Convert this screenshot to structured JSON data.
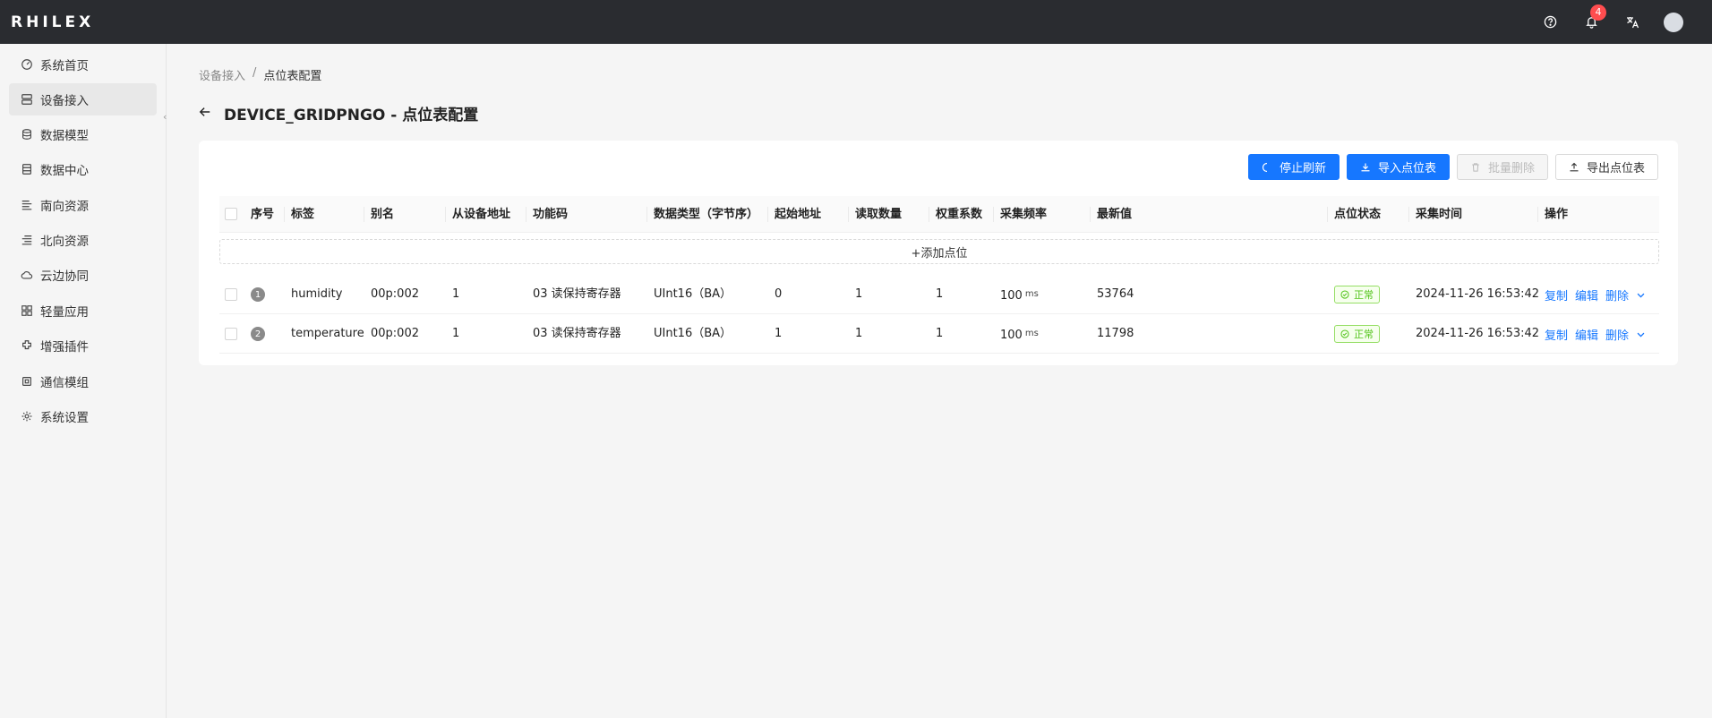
{
  "app": {
    "brand": "RHILEX",
    "notification_count": "4"
  },
  "sidebar": {
    "items": [
      {
        "label": "系统首页",
        "icon": "dashboard-icon"
      },
      {
        "label": "设备接入",
        "icon": "devices-icon"
      },
      {
        "label": "数据模型",
        "icon": "database-icon"
      },
      {
        "label": "数据中心",
        "icon": "table-icon"
      },
      {
        "label": "南向资源",
        "icon": "list-icon"
      },
      {
        "label": "北向资源",
        "icon": "list-icon"
      },
      {
        "label": "云边协同",
        "icon": "cloud-icon"
      },
      {
        "label": "轻量应用",
        "icon": "apps-icon"
      },
      {
        "label": "增强插件",
        "icon": "plugin-icon"
      },
      {
        "label": "通信模组",
        "icon": "chip-icon"
      },
      {
        "label": "系统设置",
        "icon": "gear-icon"
      }
    ]
  },
  "breadcrumb": {
    "parent": "设备接入",
    "separator": "/",
    "current": "点位表配置"
  },
  "page": {
    "title": "DEVICE_GRIDPNGO - 点位表配置"
  },
  "toolbar": {
    "stop_refresh": "停止刷新",
    "import": "导入点位表",
    "batch_delete": "批量删除",
    "export": "导出点位表"
  },
  "table": {
    "columns": [
      "序号",
      "标签",
      "别名",
      "从设备地址",
      "功能码",
      "数据类型（字节序）",
      "起始地址",
      "读取数量",
      "权重系数",
      "采集频率",
      "最新值",
      "点位状态",
      "采集时间",
      "操作"
    ],
    "add_point": "+添加点位",
    "rows": [
      {
        "index": "1",
        "tag": "humidity",
        "alias": "00p:002",
        "slave_addr": "1",
        "func_code": "03 读保持寄存器",
        "data_type": "UInt16（BA）",
        "start_addr": "0",
        "read_count": "1",
        "weight": "1",
        "freq": "100",
        "freq_unit": "ms",
        "latest": "53764",
        "status": "正常",
        "time": "2024-11-26 16:53:42",
        "op_copy": "复制",
        "op_edit": "编辑",
        "op_delete": "删除"
      },
      {
        "index": "2",
        "tag": "temperature",
        "alias": "00p:002",
        "slave_addr": "1",
        "func_code": "03 读保持寄存器",
        "data_type": "UInt16（BA）",
        "start_addr": "1",
        "read_count": "1",
        "weight": "1",
        "freq": "100",
        "freq_unit": "ms",
        "latest": "11798",
        "status": "正常",
        "time": "2024-11-26 16:53:42",
        "op_copy": "复制",
        "op_edit": "编辑",
        "op_delete": "删除"
      }
    ]
  },
  "colors": {
    "primary": "#1677ff",
    "success": "#52c41a",
    "topbar": "#2a2c30",
    "badge": "#ff4d4f"
  }
}
